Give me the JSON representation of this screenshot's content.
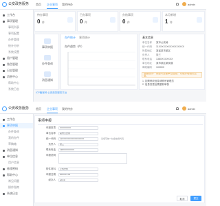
{
  "app": {
    "brand": "公安政务服务"
  },
  "top": {
    "tabs": [
      "首页",
      "企业事项",
      "我的待办"
    ],
    "tab_active_index": 1,
    "user": "admin"
  },
  "sidebar_top": {
    "items": [
      {
        "label": "工作台",
        "active": false,
        "sub": false
      },
      {
        "label": "事项管理",
        "active": false,
        "sub": false
      },
      {
        "label": "事项列表",
        "active": false,
        "sub": true
      },
      {
        "label": "事项配置",
        "active": false,
        "sub": true
      },
      {
        "label": "办件管理",
        "active": false,
        "sub": true
      },
      {
        "label": "统计分析",
        "active": false,
        "sub": true
      },
      {
        "label": "系统设置",
        "active": false,
        "sub": true
      },
      {
        "label": "用户管理",
        "active": false,
        "sub": false
      },
      {
        "label": "角色管理",
        "active": false,
        "sub": false
      },
      {
        "label": "日志管理",
        "active": false,
        "sub": false
      },
      {
        "label": "消息中心",
        "active": false,
        "sub": false
      },
      {
        "label": "帮助中心",
        "active": false,
        "sub": true
      },
      {
        "label": "系统日志",
        "active": false,
        "sub": true
      }
    ]
  },
  "stats": [
    {
      "label": "待办事项",
      "value": "0",
      "unit": "件"
    },
    {
      "label": "已办事项",
      "value": "0",
      "unit": "件"
    },
    {
      "label": "办结事项",
      "value": "0",
      "unit": "件"
    },
    {
      "label": "本月新增",
      "value": "1",
      "unit": "件"
    }
  ],
  "modules": [
    "事项申报",
    "办件查询",
    "消息通知"
  ],
  "chart": {
    "tabs": [
      "办件统计",
      "事项统计"
    ],
    "title": "办件趋势（件）"
  },
  "chart_data": {
    "type": "line",
    "title": "办件趋势（件）",
    "x": [],
    "series": [],
    "ylabel": "",
    "xlabel": ""
  },
  "info": {
    "title": "基本信息",
    "rows": [
      {
        "k": "单位名称",
        "v": "某市公安局"
      },
      {
        "k": "统一代码",
        "v": "11XXXXXXXXXXXXXXXX"
      },
      {
        "k": "所属地区",
        "v": "某省某市某区"
      },
      {
        "k": "负责人",
        "v": "张三"
      },
      {
        "k": "联系电话",
        "v": "138XXXXXXXX"
      },
      {
        "k": "单位地址",
        "v": "某市某区某街道"
      },
      {
        "k": "邮政编码",
        "v": "100000"
      }
    ],
    "notice": "温馨提示：请及时完善单位信息，以便办理相关业务。",
    "tips": [
      "1. 如需修改信息请联系管理员",
      "2. 信息变更后需重新审核"
    ]
  },
  "footnote": "ICP备案号 公安政务服务平台",
  "sidebar_bottom": {
    "items": [
      {
        "label": "工作台",
        "active": false,
        "sub": false
      },
      {
        "label": "事项申报",
        "active": true,
        "sub": false
      },
      {
        "label": "办件查询",
        "active": false,
        "sub": true
      },
      {
        "label": "我的办件",
        "active": false,
        "sub": true
      },
      {
        "label": "草稿箱",
        "active": false,
        "sub": true
      },
      {
        "label": "消息通知",
        "active": false,
        "sub": false
      },
      {
        "label": "单位信息",
        "active": false,
        "sub": false
      },
      {
        "label": "用户信息",
        "active": false,
        "sub": true
      },
      {
        "label": "修改密码",
        "active": false,
        "sub": false
      },
      {
        "label": "帮助中心",
        "active": false,
        "sub": false
      },
      {
        "label": "常见问题",
        "active": false,
        "sub": true
      },
      {
        "label": "操作指南",
        "active": false,
        "sub": true
      },
      {
        "label": "系统日志",
        "active": false,
        "sub": false
      }
    ]
  },
  "form": {
    "title": "事项申报",
    "fields": [
      {
        "label": "申报事项",
        "value": "XXXXXXXX",
        "note": ""
      },
      {
        "label": "单位名称",
        "value": "某市公安局",
        "note": ""
      },
      {
        "label": "统一代码",
        "value": "11XXXXXXXXXXXXXXXX",
        "note": "请填写统一社会信用代码"
      },
      {
        "label": "负责人",
        "value": "张三",
        "note": ""
      },
      {
        "label": "联系电话",
        "value": "138XXXXXXXX",
        "note": ""
      }
    ],
    "remark_label": "申报说明",
    "extra_fields": [
      {
        "label": "附件材料",
        "value": "上传文件",
        "note": ""
      },
      {
        "label": "申报日期",
        "value": "2023-01-01",
        "note": ""
      },
      {
        "label": "经办人",
        "value": "admin",
        "note": ""
      }
    ],
    "buttons": {
      "cancel": "取消",
      "submit": "提交"
    }
  }
}
